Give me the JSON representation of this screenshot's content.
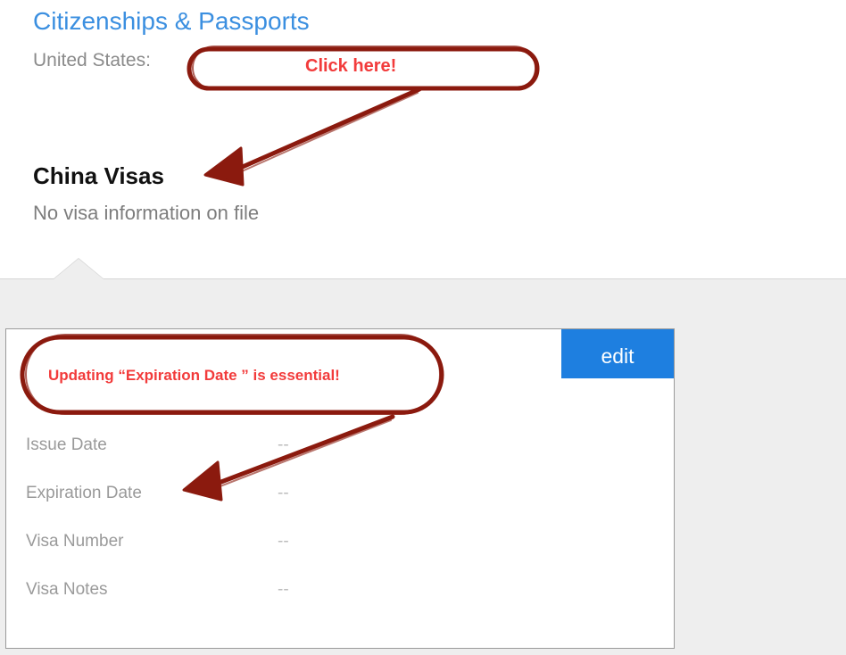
{
  "header": {
    "section_link": "Citizenships & Passports",
    "citizenship_country": "United States:"
  },
  "china_visas": {
    "title": "China Visas",
    "empty_message": "No visa information on file"
  },
  "visa_card": {
    "edit_label": "edit",
    "fields": [
      {
        "label": "Issue Date",
        "value": "--"
      },
      {
        "label": "Expiration Date",
        "value": "--"
      },
      {
        "label": "Visa Number",
        "value": "--"
      },
      {
        "label": "Visa Notes",
        "value": "--"
      }
    ]
  },
  "annotations": {
    "callout_top": "Click here!",
    "callout_bottom": "Updating “Expiration Date ” is essential!",
    "annotation_color": "#8b1a0e",
    "annotation_text_color": "#f23b3b"
  },
  "colors": {
    "link": "#3b8fe0",
    "edit_button": "#1e7fe0",
    "panel_background": "#eeeeee"
  }
}
